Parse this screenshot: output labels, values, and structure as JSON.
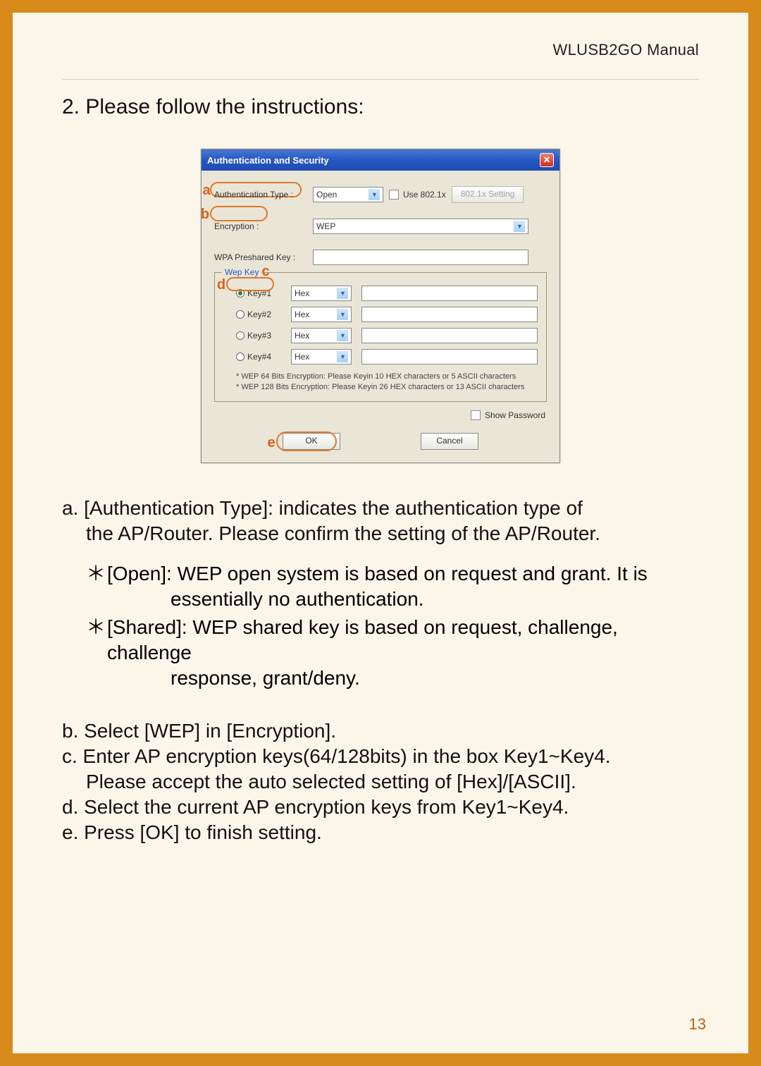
{
  "header": {
    "manual_title": "WLUSB2GO  Manual"
  },
  "section": {
    "title": "2. Please follow the instructions:"
  },
  "dialog": {
    "title": "Authentication and Security",
    "auth_type_label": "Authentication Type :",
    "auth_type_value": "Open",
    "use_8021x_label": "Use 802.1x",
    "setting_btn": "802.1x Setting",
    "encryption_label": "Encryption :",
    "encryption_value": "WEP",
    "wpa_psk_label": "WPA Preshared Key :",
    "wpa_psk_value": "",
    "wep_legend": "Wep Key",
    "keys": [
      {
        "label": "Key#1",
        "format": "Hex",
        "value": "",
        "selected": true
      },
      {
        "label": "Key#2",
        "format": "Hex",
        "value": "",
        "selected": false
      },
      {
        "label": "Key#3",
        "format": "Hex",
        "value": "",
        "selected": false
      },
      {
        "label": "Key#4",
        "format": "Hex",
        "value": "",
        "selected": false
      }
    ],
    "hint1": "* WEP 64 Bits Encryption:  Please Keyin 10 HEX characters or 5 ASCII characters",
    "hint2": "* WEP 128 Bits Encryption:  Please Keyin 26 HEX characters or 13 ASCII characters",
    "show_pw": "Show Password",
    "ok": "OK",
    "cancel": "Cancel"
  },
  "markers": {
    "a": "a",
    "b": "b",
    "c": "c",
    "d": "d",
    "e": "e"
  },
  "notes": {
    "a1": "a. [Authentication Type]: indicates the authentication type of",
    "a2": "the AP/Router. Please confirm the setting of the AP/Router.",
    "open_label": "[Open]:",
    "open_body": "WEP open system is based on request and grant. It is",
    "open_body2": "essentially no authentication.",
    "shared_label": "[Shared]:",
    "shared_body": "WEP shared key is based on request, challenge, challenge",
    "shared_body2": "response, grant/deny.",
    "b": "b. Select  [WEP] in [Encryption].",
    "c1": "c. Enter AP encryption keys(64/128bits) in the box Key1~Key4.",
    "c2": "Please accept the auto selected setting of [Hex]/[ASCII].",
    "d": "d. Select the current AP encryption keys from Key1~Key4.",
    "e": "e. Press [OK] to finish setting."
  },
  "page_number": "13",
  "glyphs": {
    "star": "＊"
  }
}
